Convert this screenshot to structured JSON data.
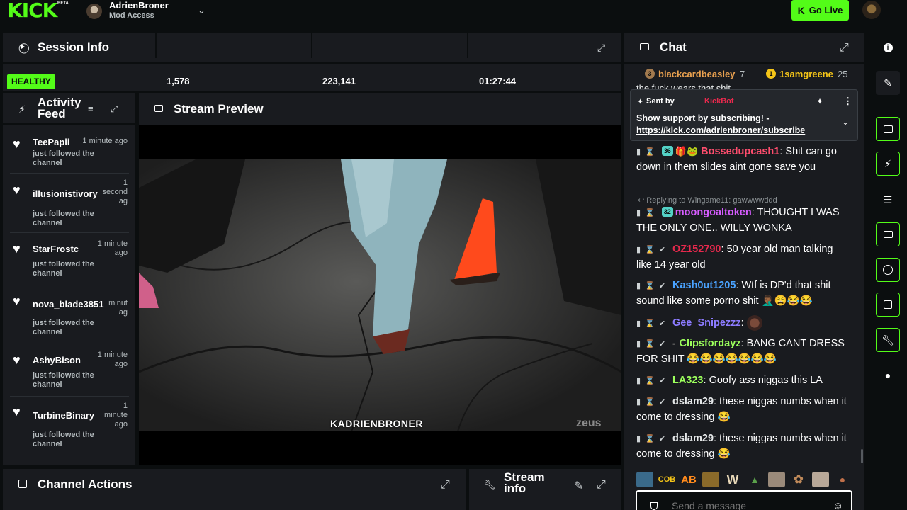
{
  "topbar": {
    "logo": "KICK",
    "logo_badge": "BETA",
    "channel_name": "AdrienBroner",
    "channel_role": "Mod Access",
    "go_live": "Go Live"
  },
  "session": {
    "title": "Session Info",
    "status": "HEALTHY",
    "stats": [
      "1,578",
      "223,141",
      "01:27:44"
    ]
  },
  "activity": {
    "title_line1": "Activity",
    "title_line2": "Feed",
    "items": [
      {
        "user": "TeePapii",
        "time": "1 minute ago",
        "action": "just followed the channel"
      },
      {
        "user": "illusionistivory",
        "time": "1 second ag",
        "action": "just followed the channel"
      },
      {
        "user": "StarFrostc",
        "time": "1 minute ago",
        "action": "just followed the channel"
      },
      {
        "user": "nova_blade3851",
        "time": "minut ag",
        "action": "just followed the channel"
      },
      {
        "user": "AshyBison",
        "time": "1 minute ago",
        "action": "just followed the channel"
      },
      {
        "user": "TurbineBinary",
        "time": "1 minute ago",
        "action": "just followed the channel"
      }
    ]
  },
  "preview": {
    "title": "Stream Preview",
    "watermark": "KADRIENBRONER",
    "corner_logo": "zeus"
  },
  "actions": {
    "title": "Channel Actions"
  },
  "streaminfo": {
    "title_line1": "Stream",
    "title_line2": "info"
  },
  "chat": {
    "title": "Chat",
    "top_gifters": [
      {
        "rank": "3",
        "name": "blackcardbeasley",
        "count": "7"
      },
      {
        "rank": "1",
        "name": "1samgreene",
        "count": "25"
      }
    ],
    "clipped_line": "the fuck wears that shit",
    "pinned": {
      "sent_by_label": "Sent by",
      "sender": "KickBot",
      "text": "Show support by subscribing! -",
      "link": "https://kick.com/adrienbroner/subscribe"
    },
    "reply_context": "Replying to Wingame11: gawwwwddd",
    "messages": [
      {
        "badge": "36",
        "user": "Bossedupcash1",
        "color": "#ff4d6d",
        "text": "Shit can go down in them slides aint gone save you"
      },
      {
        "badge": "32",
        "user": "moongoaltoken",
        "color": "#d65cff",
        "text": "THOUGHT I WAS THE ONLY ONE.. WILLY WONKA"
      },
      {
        "badge": "",
        "user": "OZ152790",
        "color": "#e8294d",
        "text": "50 year old man talking like 14 year old"
      },
      {
        "badge": "",
        "user": "Kash0ut1205",
        "color": "#4aa3ff",
        "text": "Wtf is DP'd that shit sound like some porno shit 🤦🏾‍♂️😩😂😂"
      },
      {
        "badge": "",
        "user": "Gee_Snipezzz",
        "color": "#8c7bff",
        "text": ""
      },
      {
        "badge": "",
        "user": "Clipsfordayz",
        "color": "#9cff5c",
        "text": "BANG CANT DRESS FOR SHIT 😂😂😂😂😂😂😂"
      },
      {
        "badge": "",
        "user": "LA323",
        "color": "#9cff5c",
        "text": "Goofy ass niggas this LA"
      },
      {
        "badge": "",
        "user": "dslam29",
        "color": "#e6e9ea",
        "text": "these niggas numbs when it come to dressing 😂"
      },
      {
        "badge": "",
        "user": "dslam29",
        "color": "#e6e9ea",
        "text": "these niggas numbs when it come to dressing 😂"
      }
    ],
    "emotes": [
      "COB",
      "AB",
      "W"
    ],
    "input_placeholder": "Send a message"
  },
  "colors": {
    "accent": "#53fc18",
    "panel": "#191b1f",
    "background": "#0b0e0f"
  }
}
